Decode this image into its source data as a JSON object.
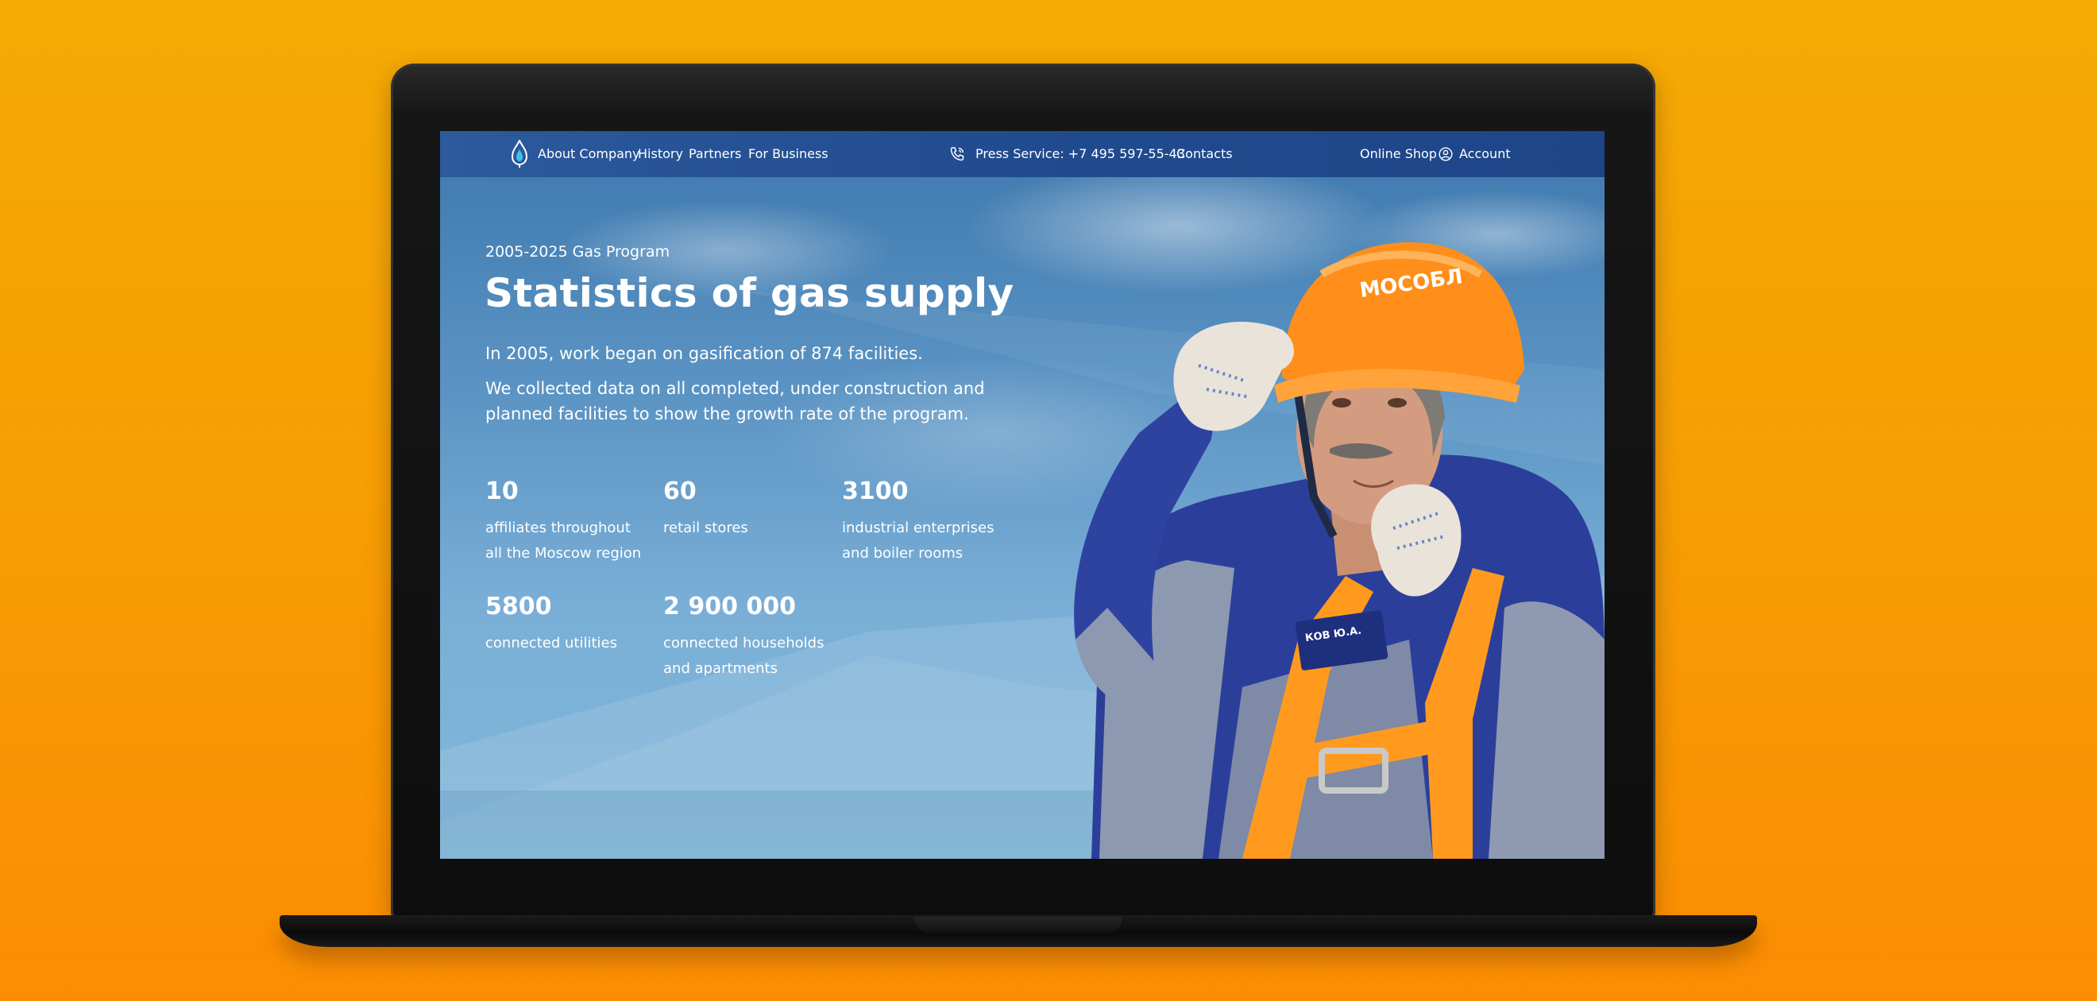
{
  "nav": {
    "left_links": [
      "About Company",
      "History",
      "Partners",
      "For Business"
    ],
    "press_label": "Press Service: +7 495 597-55-43",
    "contacts_label": "Contacts",
    "shop_label": "Online Shop",
    "account_label": "Account"
  },
  "hero": {
    "eyebrow": "2005-2025 Gas Program",
    "title": "Statistics of gas supply",
    "paragraph_1": "In 2005, work began on gasification of 874 facilities.",
    "paragraph_2_line_1": "We collected data on all completed, under construction and",
    "paragraph_2_line_2": "planned facilities to show the growth rate of the program."
  },
  "stats": [
    {
      "value": "10",
      "label_lines": [
        "affiliates throughout",
        "all the Moscow region"
      ]
    },
    {
      "value": "60",
      "label_lines": [
        "retail stores"
      ]
    },
    {
      "value": "3100",
      "label_lines": [
        "industrial enterprises",
        "and boiler rooms"
      ]
    },
    {
      "value": "5800",
      "label_lines": [
        "connected utilities"
      ]
    },
    {
      "value": "2 900 000",
      "label_lines": [
        "connected households",
        "and apartments"
      ]
    }
  ],
  "photo": {
    "helmet_text": "МОСОБЛ",
    "badge_text": "КОВ Ю.А."
  },
  "icons": [
    "gas-flame-logo-icon",
    "phone-icon",
    "account-icon"
  ],
  "colors": {
    "background_orange": "#f79d04",
    "nav_blue": "#214b8f",
    "helmet_orange": "#ff8f1a",
    "uniform_blue": "#2b3f9a"
  }
}
